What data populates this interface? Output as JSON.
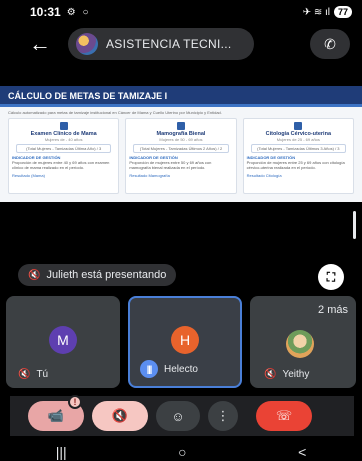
{
  "status_bar": {
    "time": "10:31",
    "left_icons": "⚙ ○",
    "right_icons": "✈ ≋ ıl",
    "battery": "77"
  },
  "header": {
    "back_icon": "arrow-left-icon",
    "title": "ASISTENCIA TECNI...",
    "switch_icon": "phone-switch-icon"
  },
  "shared_screen": {
    "banner_title": "CÁLCULO DE METAS DE TAMIZAJE I",
    "intro": "Cálculo automatizado para metas de tamizaje institucional en Cáncer de Mama y Cuello Uterino por Municipio y Entidad.",
    "cards": [
      {
        "title": "Examen Clínico de Mama",
        "subtitle": "Mujeres de - 40 años",
        "box": "(Total Mujeres - Tamizadas Última Año) / 3",
        "section": "INDICADOR DE GESTIÓN",
        "text": "Proporción de mujeres entre 40 y 69 años con examen clínico de mama realizado en el período.",
        "link": "Resultado (Mama)"
      },
      {
        "title": "Mamografía Bienal",
        "subtitle": "Mujeres de 50 - 69 años",
        "box": "(Total Mujeres - Tamizadas Últimos 2 Años) / 2",
        "section": "INDICADOR DE GESTIÓN",
        "text": "Proporción de mujeres entre 50 y 69 años con mamografía bienal realizada en el período.",
        "link": "Resultado Mamografía"
      },
      {
        "title": "Citología Cérvico-uterina",
        "subtitle": "Mujeres de 25 - 69 años",
        "box": "(Total Mujeres - Tamizadas Últimos 3 Años) / 3",
        "section": "INDICADOR DE GESTIÓN",
        "text": "Proporción de mujeres entre 25 y 69 años con citología cérvico-uterina realizada en el período.",
        "link": "Resultado Citología"
      }
    ]
  },
  "presenting": {
    "text": "Julieth está presentando",
    "mic_icon": "mic-off-icon",
    "fullscreen_icon": "fullscreen-icon"
  },
  "participants": [
    {
      "initial": "M",
      "name": "Tú",
      "color": "#5e3fb0",
      "muted": true
    },
    {
      "initial": "H",
      "name": "Helecto",
      "color": "#e8632c",
      "speaking": true
    },
    {
      "initial": "",
      "name": "Yeithy",
      "color": "#6e9c5a",
      "muted": true
    }
  ],
  "more_count": "2 más",
  "controls": {
    "camera_icon": "camera-off-icon",
    "camera_badge": "!",
    "mic_icon": "mic-off-icon",
    "emoji_icon": "emoji-icon",
    "more_icon": "more-vert-icon",
    "end_icon": "call-end-icon"
  },
  "nav": {
    "recents_icon": "recents-icon",
    "home_icon": "home-icon",
    "back_icon": "back-icon"
  },
  "colors": {
    "accent": "#4a7fd8",
    "end_call": "#ea4335",
    "muted_pill": "#f6c7c2",
    "banner": "#1f3c78"
  }
}
